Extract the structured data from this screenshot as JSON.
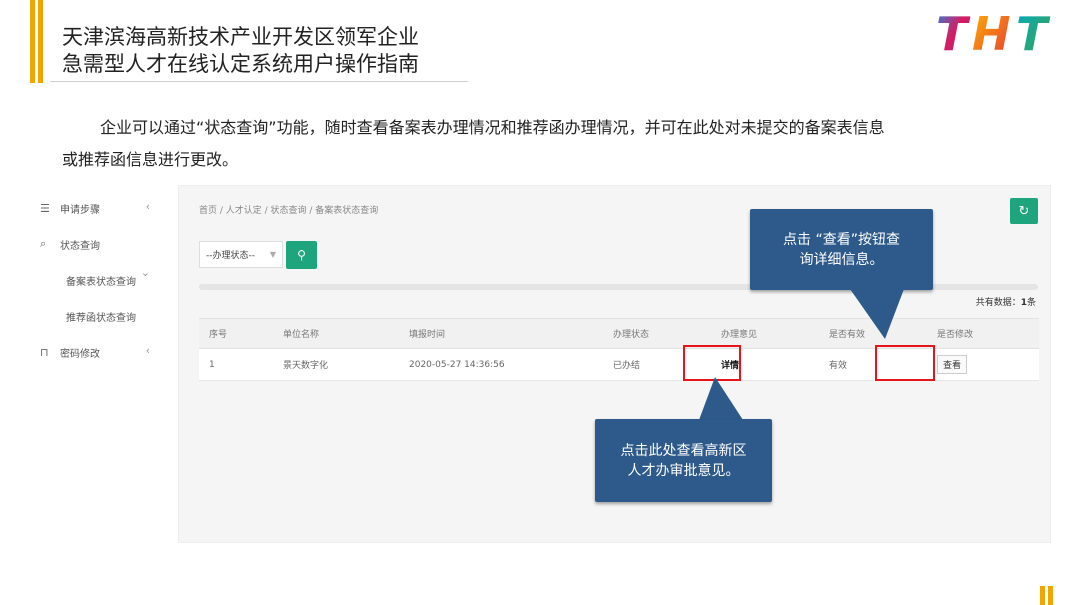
{
  "slide": {
    "title_line1": "天津滨海高新技术产业开发区领军企业",
    "title_line2": "急需型人才在线认定系统用户操作指南",
    "logo_text": "THT",
    "intro_line1": "企业可以通过“状态查询”功能，随时查看备案表办理情况和推荐函办理情况，并可在此处对未提交的备案表信息",
    "intro_line2": "或推荐函信息进行更改。"
  },
  "sidebar": {
    "items": [
      {
        "label": "申请步骤",
        "icon": "apply-list-icon"
      },
      {
        "label": "状态查询",
        "icon": "search-icon"
      },
      {
        "label": "备案表状态查询"
      },
      {
        "label": "推荐函状态查询"
      },
      {
        "label": "密码修改",
        "icon": "lock-icon"
      }
    ]
  },
  "app": {
    "breadcrumb": "首页 / 人才认定 / 状态查询 / 备案表状态查询",
    "status_select": "--办理状态--",
    "total_label": "共有数据：",
    "total_count": "1",
    "total_unit": "条",
    "table": {
      "headers": [
        "序号",
        "单位名称",
        "填报时间",
        "办理状态",
        "办理意见",
        "是否有效",
        "是否修改"
      ],
      "rows": [
        [
          "1",
          "景天数字化",
          "2020-05-27 14:36:56",
          "已办结",
          "详情",
          "有效",
          "查看"
        ]
      ]
    }
  },
  "callouts": {
    "view": "点击“查看”按钮查询详细信息。",
    "view_line1": "点击 “查看”按钮查",
    "view_line2": "询详细信息。",
    "opinion_line1": "点击此处查看高新区",
    "opinion_line2": "人才办审批意见。"
  },
  "colors": {
    "accent": "#f0a500",
    "primary_green": "#1fa57e",
    "callout_blue": "#2e5a8b",
    "highlight_red": "#e8141b"
  }
}
